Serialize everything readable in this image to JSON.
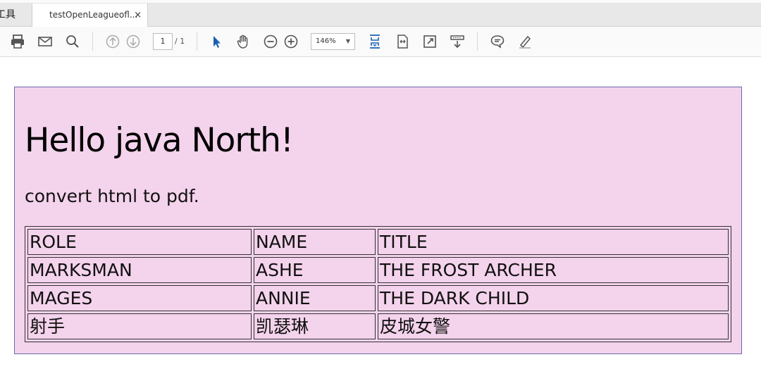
{
  "tabs": {
    "tools_label": "工具",
    "document_title": "testOpenLeagueofl...",
    "close_glyph": "×"
  },
  "toolbar": {
    "icons": [
      "print-icon",
      "email-icon",
      "search-icon",
      "previous-page-icon",
      "next-page-icon",
      "select-arrow-icon",
      "hand-icon",
      "zoom-out-icon",
      "zoom-in-icon",
      "fit-page-icon",
      "fit-width-icon",
      "full-screen-icon",
      "read-mode-icon",
      "comment-icon",
      "highlight-icon"
    ],
    "current_page": "1",
    "total_pages": "/ 1",
    "zoom_level": "146%"
  },
  "document": {
    "heading": "Hello java North!",
    "subtext": "convert html to pdf.",
    "background_color": "#f4d3ec",
    "table": {
      "headers": [
        "ROLE",
        "NAME",
        "TITLE"
      ],
      "rows": [
        [
          "MARKSMAN",
          "ASHE",
          "THE FROST ARCHER"
        ],
        [
          "MAGES",
          "ANNIE",
          "THE DARK CHILD"
        ],
        [
          "射手",
          "凯瑟琳",
          "皮城女警"
        ]
      ]
    }
  }
}
